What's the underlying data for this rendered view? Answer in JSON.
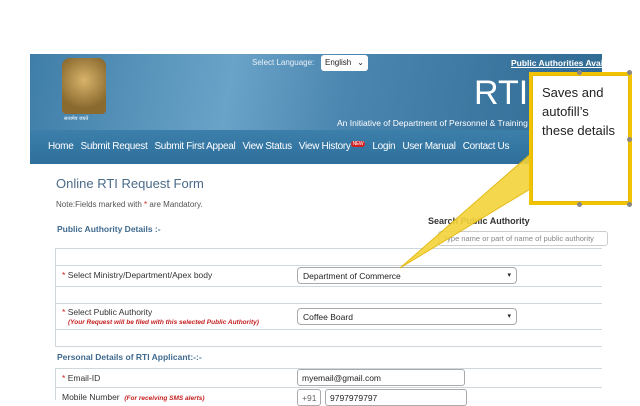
{
  "header": {
    "emblem_caption": "सत्यमेव जयते",
    "language_label": "Select Language:",
    "language_value": "English",
    "public_authorities_link": "Public Authorities Available",
    "logo_text": "RTI",
    "tagline": "An Initiative of Department of Personnel & Training"
  },
  "nav": {
    "items": [
      "Home",
      "Submit Request",
      "Submit First Appeal",
      "View Status",
      "View History",
      "Login",
      "User Manual",
      "Contact Us"
    ],
    "new_badge": "NEW"
  },
  "form": {
    "title": "Online RTI Request Form",
    "note_prefix": "Note:Fields marked with ",
    "note_star": "*",
    "note_suffix": " are Mandatory.",
    "pa_section": "Public Authority Details :-",
    "search_label": "Search Public Authority",
    "search_placeholder": "Type name or part of name of public authority",
    "ministry_label": "Select Ministry/Department/Apex body",
    "ministry_value": "Department of Commerce",
    "authority_label": "Select Public Authority",
    "authority_sub": "(Your Request will be filed with this selected Public Authority)",
    "authority_value": "Coffee Board",
    "personal_section": "Personal Details of RTI Applicant:-:-",
    "email_label": "Email-ID",
    "email_value": "myemail@gmail.com",
    "mobile_label": "Mobile Number",
    "mobile_sub": "(For receiving SMS alerts)",
    "mobile_code": "+91",
    "mobile_value": "9797979797",
    "star": "*"
  },
  "callout": {
    "text": "Saves and autofill’s these details"
  },
  "colors": {
    "header": "#3f7ea8",
    "callout_border": "#f2c300",
    "mandatory": "#d42020"
  }
}
